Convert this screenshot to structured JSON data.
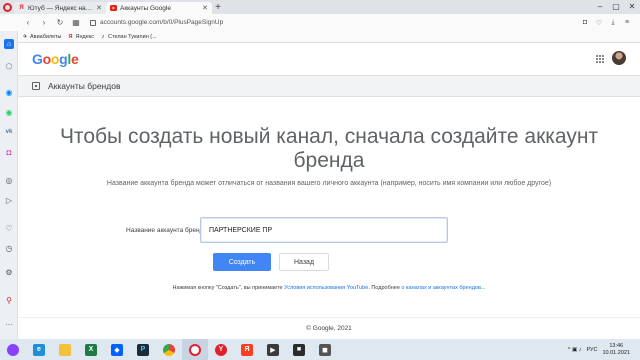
{
  "browser": {
    "tabs": [
      {
        "title": "Ютуб — Яндекс нашлось",
        "favicon": "yandex-icon",
        "active": false
      },
      {
        "title": "Аккаунты Google",
        "favicon": "youtube-icon",
        "active": true
      }
    ],
    "new_tab": "+",
    "window_controls": {
      "minimize": "–",
      "maximize": "▢",
      "close": "✕"
    },
    "address": "accounts.google.com/b/0/PlusPageSignUp",
    "bookmarks": [
      {
        "label": "Авиабилеты",
        "icon": "plane-icon"
      },
      {
        "label": "Яндекс",
        "icon": "yandex-icon"
      },
      {
        "label": "Стелан Тукилин (...",
        "icon": "tiktok-icon"
      }
    ]
  },
  "page": {
    "logo": {
      "G": "G",
      "o1": "o",
      "o2": "o",
      "g": "g",
      "l": "l",
      "e": "e"
    },
    "section_title": "Аккаунты брендов",
    "headline": "Чтобы создать новый канал, сначала создайте аккаунт бренда",
    "description": "Название аккаунта бренда может отличаться от названия вашего личного аккаунта (например, носить имя компании или любое другое)",
    "form": {
      "label": "Название аккаунта бренда",
      "value": "ПАРТНЁРСКИЕ ПР"
    },
    "buttons": {
      "create": "Создать",
      "back": "Назад"
    },
    "terms": {
      "prefix": "Нажимая кнопку \"Создать\", вы принимаете ",
      "link1": "Условия использования YouTube",
      "middle": ". Подробнее ",
      "link2": "о каналах и аккаунтах брендов...",
      "suffix": ""
    },
    "footer": "© Google, 2021"
  },
  "taskbar": {
    "lang": "РУС",
    "time": "13:46",
    "date": "10.01.2021"
  },
  "colors": {
    "google_blue": "#4285f4",
    "google_red": "#ea4335",
    "google_yellow": "#fbbc05",
    "google_green": "#34a853",
    "link": "#1a73e8"
  }
}
